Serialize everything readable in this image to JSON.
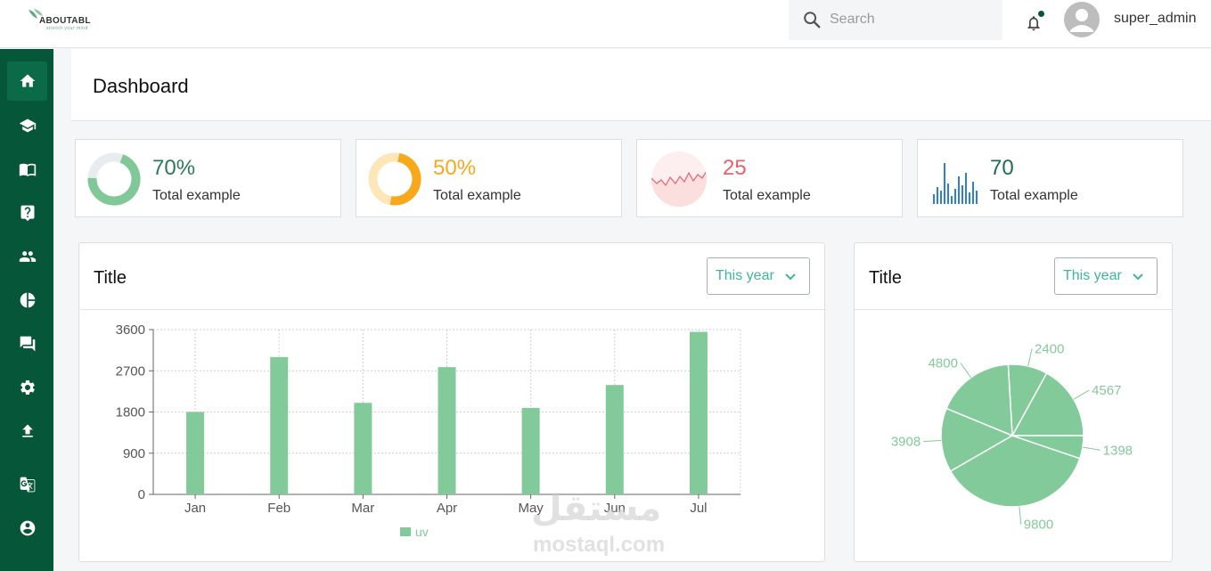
{
  "brand": {
    "name": "ABOUTABL",
    "tagline": "stretch your mind"
  },
  "header": {
    "search_placeholder": "Search",
    "username": "super_admin"
  },
  "sidebar": {
    "items": [
      {
        "icon": "home-icon",
        "active": true
      },
      {
        "icon": "graduation-cap-icon"
      },
      {
        "icon": "book-icon"
      },
      {
        "icon": "question-icon"
      },
      {
        "icon": "users-icon"
      },
      {
        "icon": "pie-chart-icon"
      },
      {
        "icon": "chat-icon"
      },
      {
        "icon": "settings-icon"
      },
      {
        "icon": "upload-icon"
      },
      {
        "icon": "translate-icon"
      },
      {
        "icon": "account-icon"
      }
    ]
  },
  "page": {
    "title": "Dashboard"
  },
  "stats": [
    {
      "value": "70%",
      "label": "Total example",
      "color": "#80c898",
      "kind": "donut",
      "percent": 70
    },
    {
      "value": "50%",
      "label": "Total example",
      "color": "#f7a81b",
      "kind": "donut",
      "percent": 50
    },
    {
      "value": "25",
      "label": "Total example",
      "color": "#e5646b",
      "kind": "sparkline"
    },
    {
      "value": "70",
      "label": "Total example",
      "color": "#1e6e4e",
      "kind": "bars"
    }
  ],
  "bar_panel": {
    "title": "Title",
    "select": "This year"
  },
  "pie_panel": {
    "title": "Title",
    "select": "This year"
  },
  "chart_data": [
    {
      "type": "bar",
      "categories": [
        "Jan",
        "Feb",
        "Mar",
        "Apr",
        "May",
        "Jun",
        "Jul"
      ],
      "series": [
        {
          "name": "uv",
          "values": [
            1800,
            3000,
            2000,
            2780,
            1890,
            2390,
            3550
          ]
        }
      ],
      "yticks": [
        0,
        900,
        1800,
        2700,
        3600
      ],
      "ylim": [
        0,
        3600
      ],
      "grid": true,
      "legend": "bottom",
      "color": "#83ca9b"
    },
    {
      "type": "pie",
      "values": [
        4567,
        2400,
        4800,
        3908,
        9800,
        1398
      ],
      "labels": [
        "4567",
        "2400",
        "4800",
        "3908",
        "9800",
        "1398"
      ],
      "color": "#83ca9b"
    }
  ],
  "watermark": {
    "arabic": "مستقل",
    "latin": "mostaql.com"
  }
}
